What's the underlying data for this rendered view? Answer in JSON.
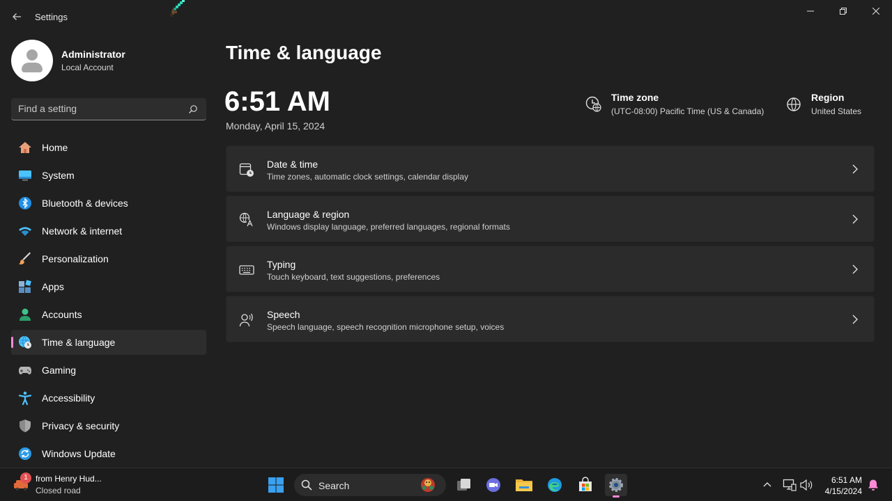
{
  "window": {
    "title": "Settings"
  },
  "profile": {
    "name": "Administrator",
    "account_type": "Local Account"
  },
  "search": {
    "placeholder": "Find a setting"
  },
  "nav": {
    "items": [
      {
        "label": "Home",
        "icon": "home-icon"
      },
      {
        "label": "System",
        "icon": "system-icon"
      },
      {
        "label": "Bluetooth & devices",
        "icon": "bluetooth-icon"
      },
      {
        "label": "Network & internet",
        "icon": "wifi-icon"
      },
      {
        "label": "Personalization",
        "icon": "brush-icon"
      },
      {
        "label": "Apps",
        "icon": "apps-icon"
      },
      {
        "label": "Accounts",
        "icon": "accounts-icon"
      },
      {
        "label": "Time & language",
        "icon": "globe-clock-icon",
        "active": true
      },
      {
        "label": "Gaming",
        "icon": "gamepad-icon"
      },
      {
        "label": "Accessibility",
        "icon": "accessibility-icon"
      },
      {
        "label": "Privacy & security",
        "icon": "shield-icon"
      },
      {
        "label": "Windows Update",
        "icon": "update-icon"
      }
    ]
  },
  "main": {
    "title": "Time & language",
    "time": "6:51 AM",
    "date": "Monday, April 15, 2024",
    "timezone": {
      "title": "Time zone",
      "value": "(UTC-08:00) Pacific Time (US & Canada)"
    },
    "region": {
      "title": "Region",
      "value": "United States"
    },
    "cards": [
      {
        "title": "Date & time",
        "subtitle": "Time zones, automatic clock settings, calendar display",
        "icon": "calendar-clock-icon"
      },
      {
        "title": "Language & region",
        "subtitle": "Windows display language, preferred languages, regional formats",
        "icon": "language-icon"
      },
      {
        "title": "Typing",
        "subtitle": "Touch keyboard, text suggestions, preferences",
        "icon": "keyboard-icon"
      },
      {
        "title": "Speech",
        "subtitle": "Speech language, speech recognition microphone setup, voices",
        "icon": "speech-icon"
      }
    ]
  },
  "taskbar": {
    "weather": {
      "badge": "1",
      "title": "from Henry Hud...",
      "subtitle": "Closed road"
    },
    "search_label": "Search",
    "tray_time": "6:51 AM",
    "tray_date": "4/15/2024"
  },
  "colors": {
    "background": "#202020",
    "card": "#2b2b2b",
    "accent": "#ff8ad8",
    "taskbar": "#1c1c1c"
  }
}
